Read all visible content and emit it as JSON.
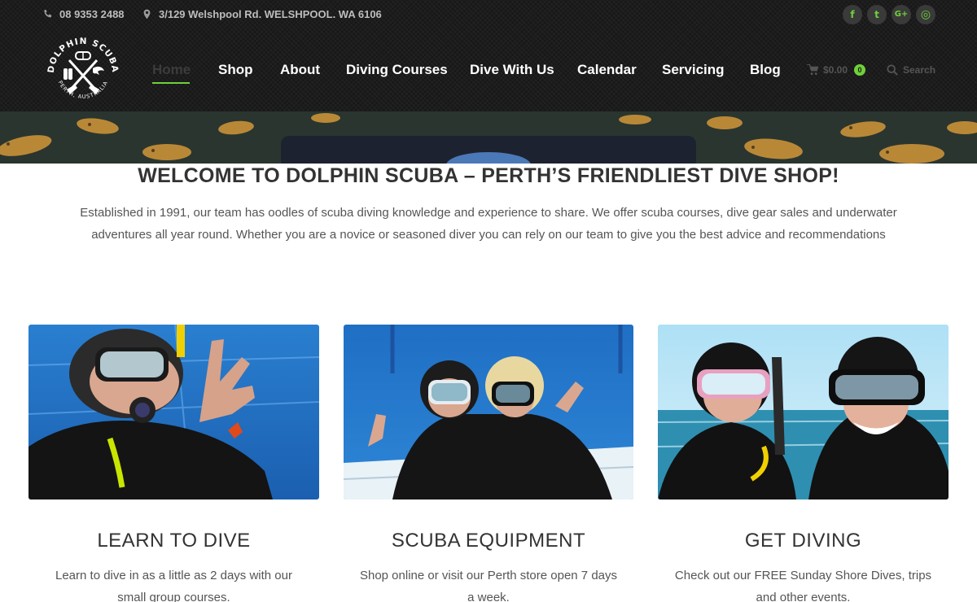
{
  "topbar": {
    "phone": "08 9353 2488",
    "address": "3/129 Welshpool Rd. WELSHPOOL. WA 6106",
    "socials": [
      {
        "icon": "facebook-icon",
        "glyph": "f"
      },
      {
        "icon": "twitter-icon",
        "glyph": "t"
      },
      {
        "icon": "google-plus-icon",
        "glyph": "G+"
      },
      {
        "icon": "dribbble-icon",
        "glyph": "◎"
      }
    ]
  },
  "logo": {
    "top_text": "DOLPHIN SCUBA",
    "bottom_text": "PERTH, AUSTRALIA"
  },
  "nav": {
    "items": [
      "Home",
      "Shop",
      "About",
      "Diving Courses",
      "Dive With Us",
      "Calendar",
      "Servicing",
      "Blog"
    ],
    "active": "Home"
  },
  "cart": {
    "total": "$0.00",
    "count": "0"
  },
  "search": {
    "label": "Search"
  },
  "welcome": {
    "title": "WELCOME TO DOLPHIN SCUBA – PERTH’S FRIENDLIEST DIVE SHOP!",
    "line1": "Established in 1991, our team has oodles of scuba diving knowledge and experience to share. We offer scuba courses, dive gear sales and underwater",
    "line2": "adventures all year round. Whether you are a novice or seasoned diver you can rely on our team to give you the best advice and recommendations"
  },
  "cards": [
    {
      "title": "LEARN TO DIVE",
      "line1": "Learn to dive in as a little as 2 days with our",
      "line2": "small group courses."
    },
    {
      "title": "SCUBA EQUIPMENT",
      "line1": "Shop online or visit our Perth store open 7 days",
      "line2": "a week."
    },
    {
      "title": "GET DIVING",
      "line1": "Check out our FREE Sunday Shore Dives, trips",
      "line2": "and other events."
    }
  ],
  "colors": {
    "accent": "#6fd13a",
    "header_bg": "#1c1c1c"
  }
}
